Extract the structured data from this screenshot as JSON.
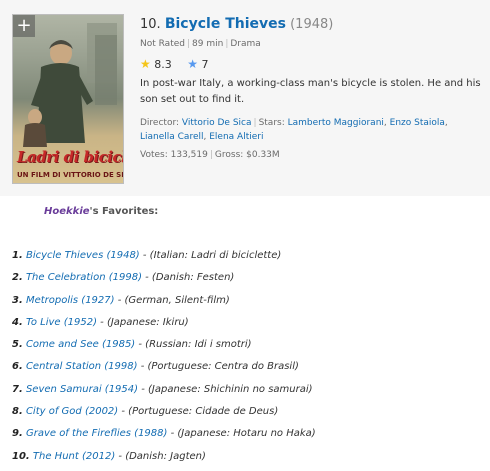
{
  "poster": {
    "add_label": "+",
    "poster_title": "Ladri di biciclette",
    "poster_credit": "UN FILM DI VITTORIO DE SICA"
  },
  "movie": {
    "rank": "10.",
    "title": "Bicycle Thieves",
    "year": "(1948)",
    "certificate": "Not Rated",
    "runtime": "89 min",
    "genre": "Drama",
    "imdb_rating": "8.3",
    "user_rating": "7",
    "description": "In post-war Italy, a working-class man's bicycle is stolen. He and his son set out to find it.",
    "director_label": "Director:",
    "director": "Vittorio De Sica",
    "stars_label": "Stars:",
    "stars": [
      "Lamberto Maggiorani",
      "Enzo Staiola",
      "Lianella Carell",
      "Elena Altieri"
    ],
    "votes": "Votes: 133,519",
    "gross": "Gross: $0.33M"
  },
  "favorites": {
    "user": "Hoekkie",
    "suffix": "'s Favorites:",
    "items": [
      {
        "num": "1.",
        "title": "Bicycle Thieves (1948)",
        "note": " - (Italian: Ladri di biciclette)"
      },
      {
        "num": "2.",
        "title": "The Celebration (1998)",
        "note": " - (Danish: Festen)"
      },
      {
        "num": "3.",
        "title": "Metropolis (1927)",
        "note": " - (German, Silent-film)"
      },
      {
        "num": "4.",
        "title": "To Live (1952)",
        "note": " - (Japanese: Ikiru)"
      },
      {
        "num": "5.",
        "title": "Come and See (1985)",
        "note": " - (Russian: Idi i smotri)"
      },
      {
        "num": "6.",
        "title": "Central Station (1998)",
        "note": " - (Portuguese: Centra do Brasil)"
      },
      {
        "num": "7.",
        "title": "Seven Samurai (1954)",
        "note": " - (Japanese: Shichinin no samurai)"
      },
      {
        "num": "8.",
        "title": "City of God (2002)",
        "note": " - (Portuguese: Cidade de Deus)"
      },
      {
        "num": "9.",
        "title": "Grave of the Fireflies (1988)",
        "note": " - (Japanese: Hotaru no Haka)"
      },
      {
        "num": "10.",
        "title": "The Hunt (2012)",
        "note": " - (Danish: Jagten)"
      }
    ]
  },
  "colors": {
    "link": "#136cb2",
    "star_gold": "#f5c518",
    "star_blue": "#5799ef",
    "username": "#6a3d9a",
    "card_bg": "#f6f6f6"
  },
  "icons": [
    "plus-icon",
    "star-gold-icon",
    "star-blue-icon"
  ]
}
